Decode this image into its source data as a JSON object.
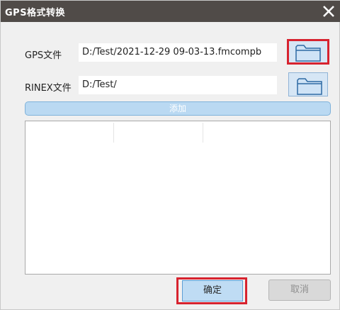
{
  "window": {
    "title": "GPS格式转换"
  },
  "gps_row": {
    "label": "GPS文件",
    "path": "D:/Test/2021-12-29 09-03-13.fmcompb"
  },
  "rinex_row": {
    "label": "RINEX文件",
    "path": "D:/Test/"
  },
  "add_button": {
    "label": "添加"
  },
  "footer": {
    "ok_label": "确定",
    "cancel_label": "取消"
  },
  "colors": {
    "titlebar": "#504b48",
    "highlight": "#d7232f",
    "accent": "#bad9f2"
  }
}
